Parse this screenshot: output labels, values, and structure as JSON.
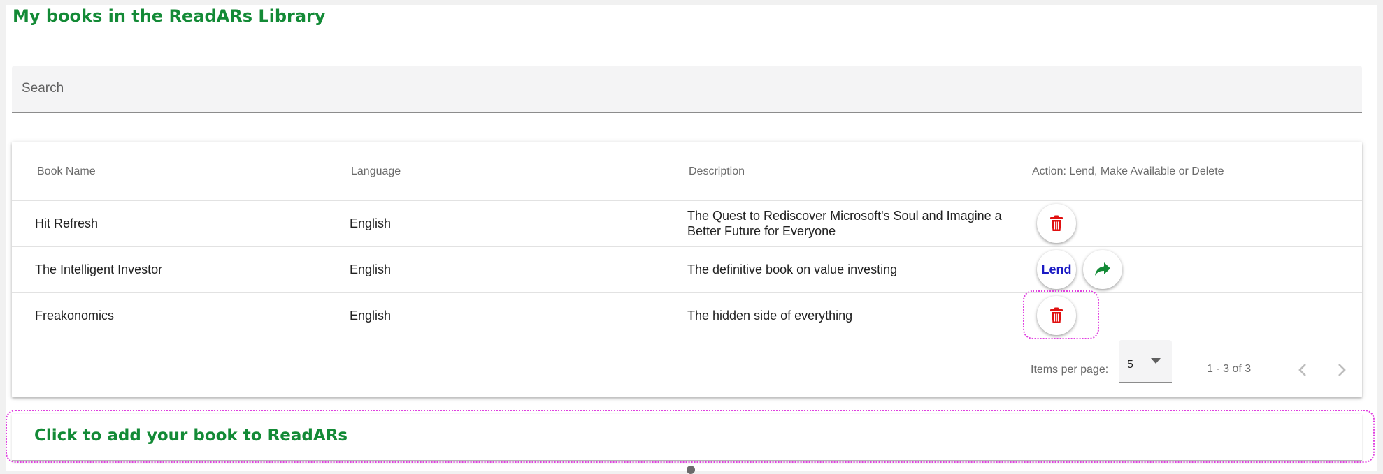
{
  "page": {
    "title": "My books in the ReadARs Library"
  },
  "search": {
    "placeholder": "Search",
    "value": ""
  },
  "table": {
    "columns": [
      "Book Name",
      "Language",
      "Description",
      "Action: Lend, Make Available or Delete"
    ],
    "rows": [
      {
        "name": "Hit Refresh",
        "language": "English",
        "description": "The Quest to Rediscover Microsoft's Soul and Imagine a Better Future for Everyone",
        "actions": [
          "delete"
        ]
      },
      {
        "name": "The Intelligent Investor",
        "language": "English",
        "description": "The definitive book on value investing",
        "actions": [
          "lend",
          "share"
        ]
      },
      {
        "name": "Freakonomics",
        "language": "English",
        "description": "The hidden side of everything",
        "actions": [
          "delete"
        ]
      }
    ],
    "lend_label": "Lend"
  },
  "pagination": {
    "items_per_page_label": "Items per page:",
    "items_per_page_value": "5",
    "range_label": "1 - 3 of 3"
  },
  "add_panel": {
    "title": "Click to add your book to ReadARs"
  },
  "icons": {
    "delete": "trash-icon",
    "share": "share-arrow-icon",
    "prev": "chevron-left-icon",
    "next": "chevron-right-icon",
    "dropdown": "caret-down-icon"
  },
  "colors": {
    "accent_green": "#138a36",
    "delete_red": "#e01010",
    "lend_blue": "#1b1bc4",
    "share_green": "#138a36",
    "highlight_magenta": "#e040e0"
  }
}
